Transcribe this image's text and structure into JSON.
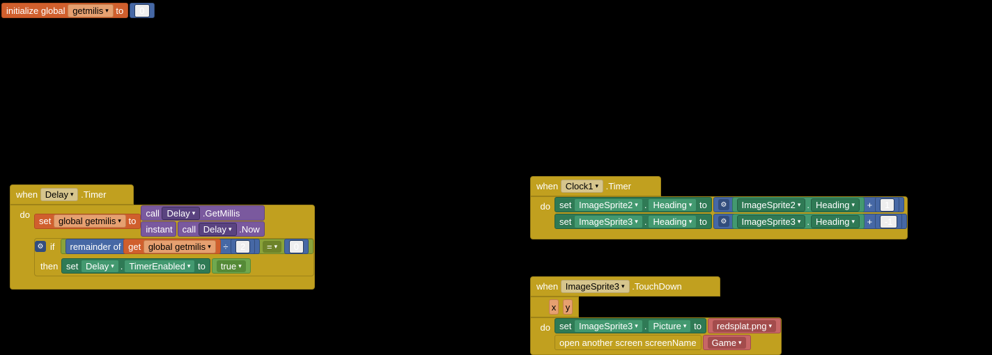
{
  "init": {
    "label": "initialize global",
    "var": "getmilis",
    "to": "to",
    "val": "0"
  },
  "delayBlock": {
    "when": "when",
    "comp": "Delay",
    "event": ".Timer",
    "do": "do",
    "set": "set",
    "gvar": "global getmilis",
    "to": "to",
    "call": "call",
    "cdelay": "Delay",
    "getmillis": ".GetMillis",
    "instant": "instant",
    "now": ".Now",
    "if": "if",
    "rem": "remainder of",
    "get": "get",
    "div": "÷",
    "divv": "2",
    "eq": "=",
    "eqv": "0",
    "then": "then",
    "teComp": "Delay",
    "teProp": "TimerEnabled",
    "teVal": "true"
  },
  "clockBlock": {
    "when": "when",
    "comp": "Clock1",
    "event": ".Timer",
    "do": "do",
    "set": "set",
    "to": "to",
    "plus": "+",
    "s2": "ImageSprite2",
    "s3": "ImageSprite3",
    "head": "Heading",
    "v1": "1",
    "vn1": "-1"
  },
  "touchBlock": {
    "when": "when",
    "comp": "ImageSprite3",
    "event": ".TouchDown",
    "x": "x",
    "y": "y",
    "do": "do",
    "set": "set",
    "pic": "Picture",
    "to": "to",
    "img": "redsplat.png",
    "open": "open another screen  screenName",
    "game": "Game"
  }
}
